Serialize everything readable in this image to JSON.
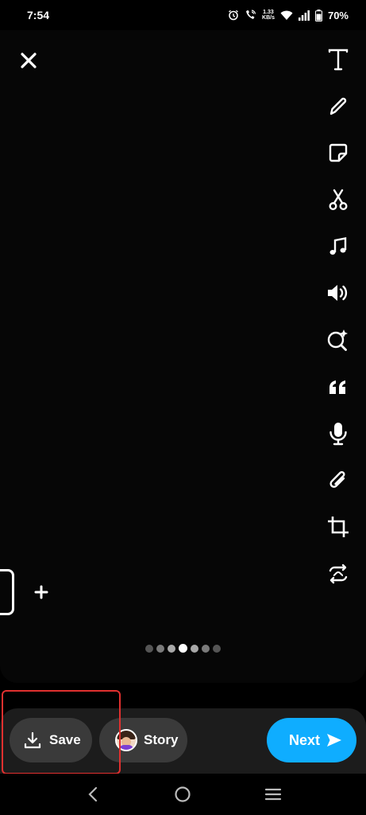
{
  "status_bar": {
    "time": "7:54",
    "net_speed_value": "1.33",
    "net_speed_unit": "KB/s",
    "battery": "70%"
  },
  "toolbar": {
    "tools": [
      "text-icon",
      "pencil-icon",
      "sticker-icon",
      "scissors-icon",
      "music-note-icon",
      "speaker-icon",
      "magic-lens-icon",
      "quote-icon",
      "microphone-icon",
      "paperclip-icon",
      "crop-icon",
      "loop-icon"
    ]
  },
  "timeline": {
    "dots_total": 7,
    "active_index": 3
  },
  "actions": {
    "save_label": "Save",
    "story_label": "Story",
    "next_label": "Next"
  },
  "colors": {
    "accent": "#0fadff",
    "highlight": "#e0302f",
    "pill_bg": "#3a3a3a"
  }
}
